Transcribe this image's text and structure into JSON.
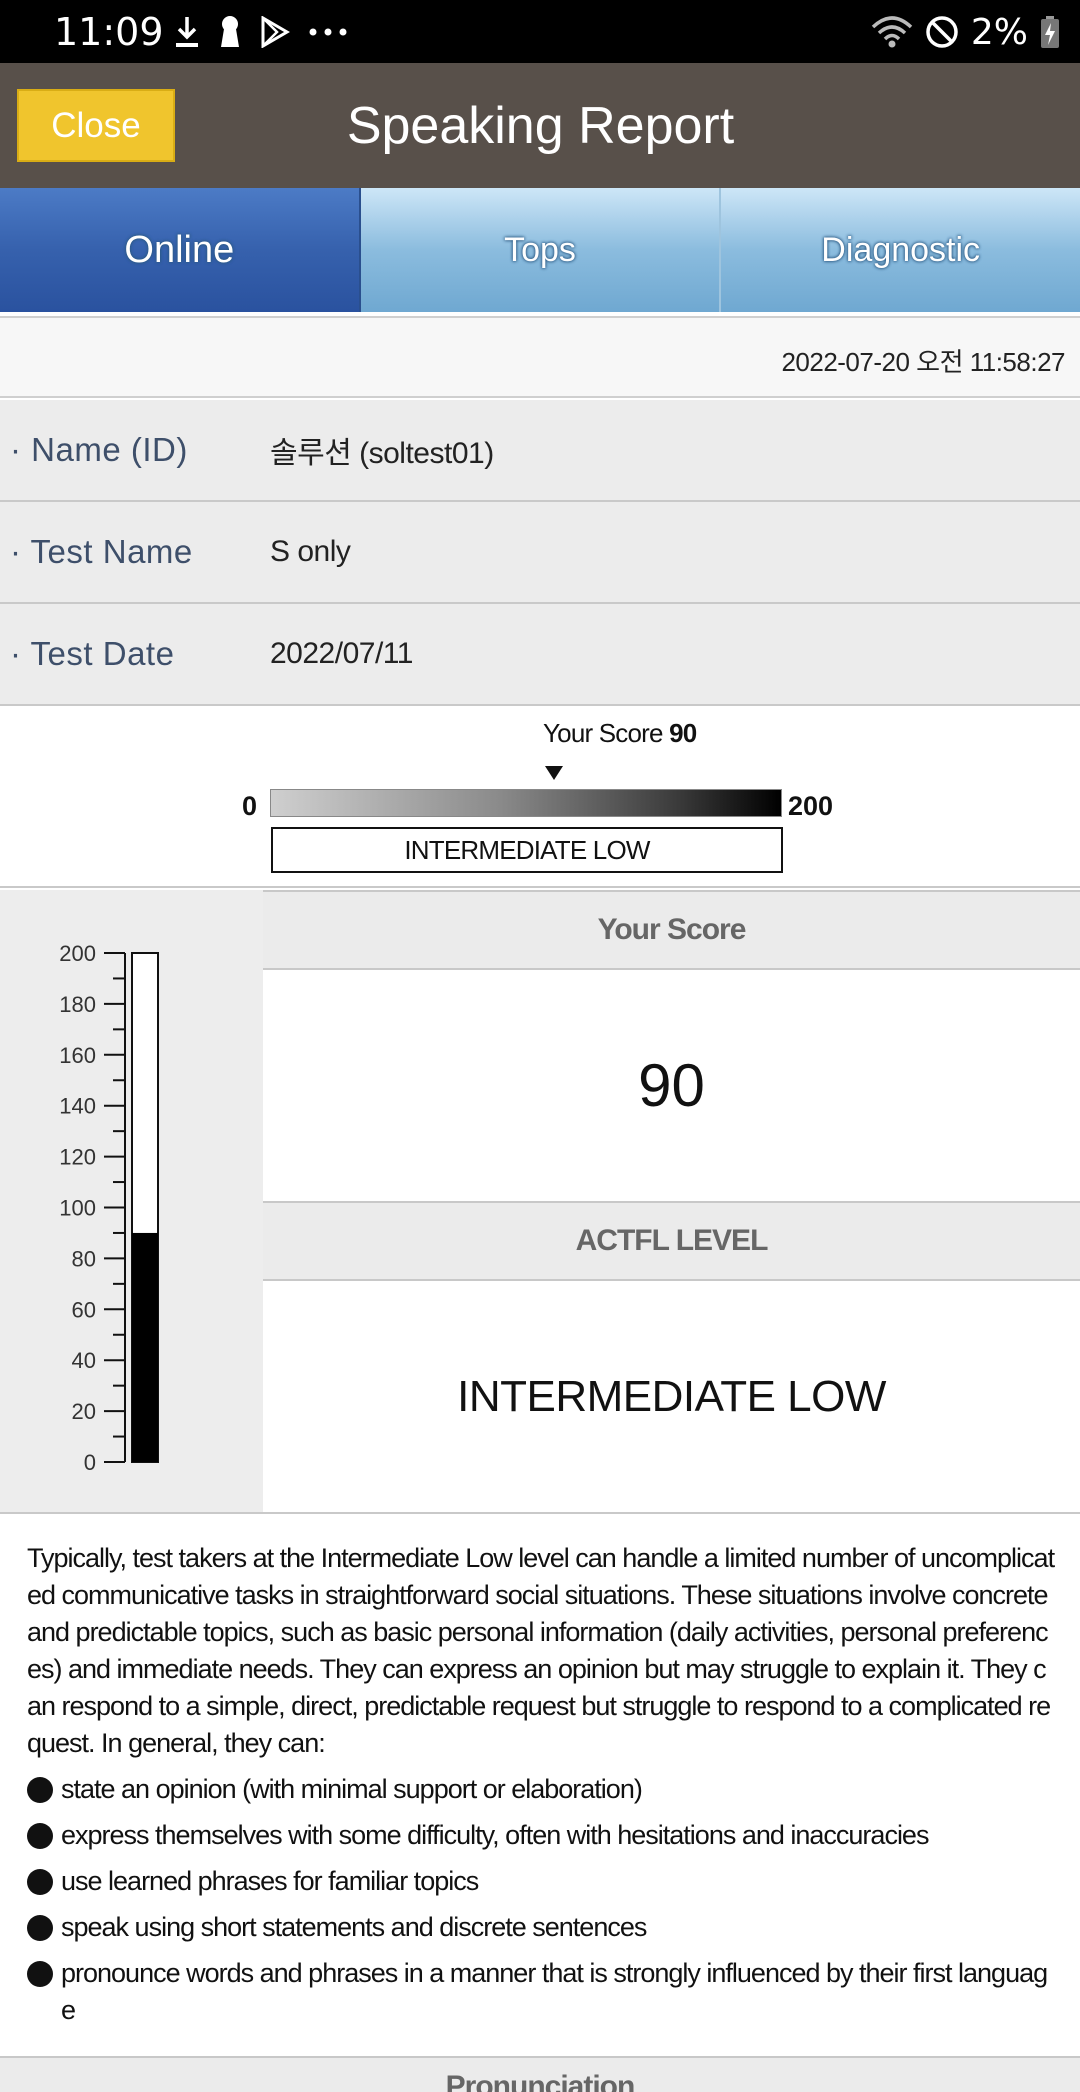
{
  "status_bar": {
    "time": "11:09",
    "battery": "2%",
    "icons": [
      "download-icon",
      "keyhole-icon",
      "play-store-icon",
      "more-dots-icon",
      "wifi-icon",
      "do-not-disturb-icon",
      "battery-charging-icon"
    ]
  },
  "header": {
    "close_label": "Close",
    "title": "Speaking Report"
  },
  "tabs": [
    {
      "label": "Online",
      "active": true
    },
    {
      "label": "Tops",
      "active": false
    },
    {
      "label": "Diagnostic",
      "active": false
    }
  ],
  "report": {
    "timestamp": "2022-07-20 오전 11:58:27",
    "info": [
      {
        "label": "· Name (ID)",
        "value": "솔루션 (soltest01)"
      },
      {
        "label": "· Test Name",
        "value": "S only"
      },
      {
        "label": "· Test Date",
        "value": "2022/07/11"
      }
    ],
    "score_bar": {
      "your_score_label": "Your Score",
      "your_score": "90",
      "min": "0",
      "max": "200",
      "level": "INTERMEDIATE LOW"
    },
    "gauge": {
      "ticks": [
        "200",
        "180",
        "160",
        "140",
        "120",
        "100",
        "80",
        "60",
        "40",
        "20",
        "0"
      ],
      "value": 90,
      "max": 200
    },
    "score_panel": {
      "score_heading": "Your Score",
      "score": "90",
      "level_heading": "ACTFL LEVEL",
      "level": "INTERMEDIATE LOW"
    },
    "description": {
      "paragraph": "Typically, test takers at the Intermediate Low level can handle a limited number of uncomplicated communicative tasks in straightforward social situations. These situations involve concrete and predictable topics, such as basic personal information (daily activities, personal preferences) and immediate needs. They can express an opinion but may struggle to explain it. They can respond to a simple, direct, predictable request but struggle to respond to a complicated request. In general, they can:",
      "bullets": [
        "state an opinion (with minimal support or elaboration)",
        "express themselves with some difficulty, often with hesitations and inaccuracies",
        "use learned phrases for familiar topics",
        "speak using short statements and discrete sentences",
        "pronounce words and phrases in a manner that is strongly influenced by their first language"
      ]
    },
    "next_section_heading": "Pronunciation"
  },
  "colors": {
    "header_bg": "#58504a",
    "close_button": "#f0c52d",
    "tab_active": "#3661ad",
    "tab_inactive": "#8bbcde",
    "label_text": "#3e4f6a"
  }
}
